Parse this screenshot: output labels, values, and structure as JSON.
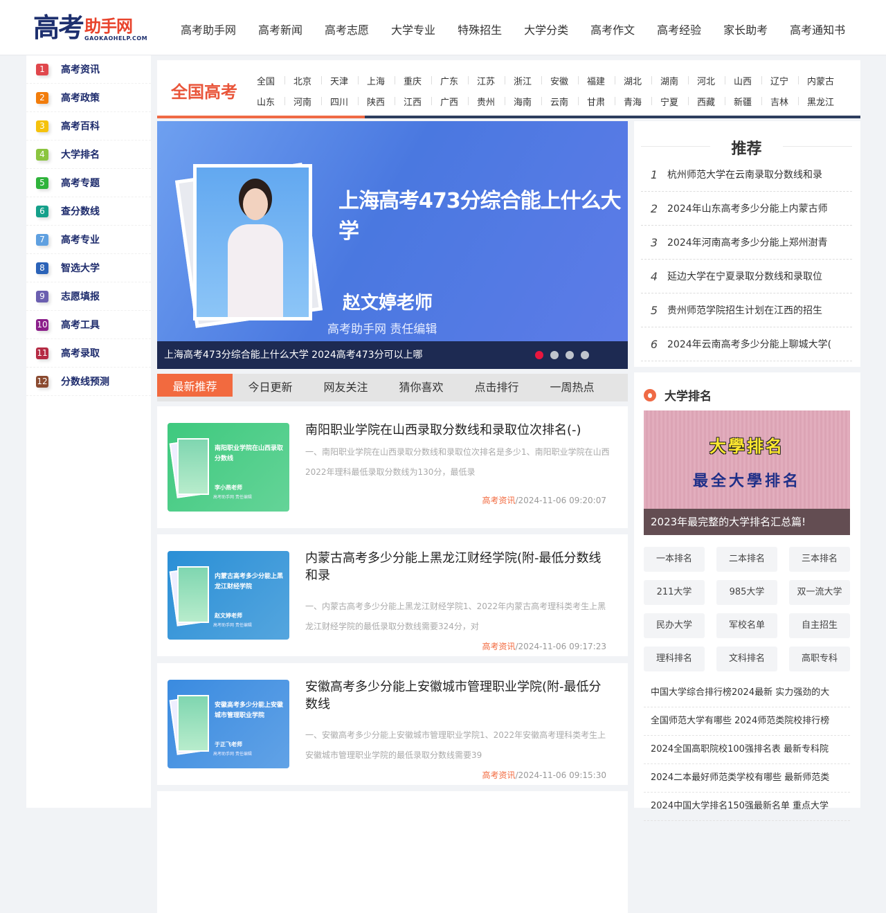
{
  "logo": {
    "cn_big": "高考",
    "cn_red": "助手网",
    "en": "GAOKAOHELP.COM"
  },
  "nav": [
    "高考助手网",
    "高考新闻",
    "高考志愿",
    "大学专业",
    "特殊招生",
    "大学分类",
    "高考作文",
    "高考经验",
    "家长助考",
    "高考通知书"
  ],
  "sidebar": [
    {
      "num": "1",
      "label": "高考资讯",
      "color": "#e0474c"
    },
    {
      "num": "2",
      "label": "高考政策",
      "color": "#f27d0c"
    },
    {
      "num": "3",
      "label": "高考百科",
      "color": "#f5c20d"
    },
    {
      "num": "4",
      "label": "大学排名",
      "color": "#8bc540"
    },
    {
      "num": "5",
      "label": "高考专题",
      "color": "#2fb33b"
    },
    {
      "num": "6",
      "label": "查分数线",
      "color": "#15a08a"
    },
    {
      "num": "7",
      "label": "高考专业",
      "color": "#5fa0e0"
    },
    {
      "num": "8",
      "label": "智选大学",
      "color": "#2b63b8"
    },
    {
      "num": "9",
      "label": "志愿填报",
      "color": "#6b5fb0"
    },
    {
      "num": "10",
      "label": "高考工具",
      "color": "#8b1e8a"
    },
    {
      "num": "11",
      "label": "高考录取",
      "color": "#b52b44"
    },
    {
      "num": "12",
      "label": "分数线预测",
      "color": "#8a4a30"
    }
  ],
  "category": {
    "title": "全国高考",
    "row1": [
      "全国",
      "北京",
      "天津",
      "上海",
      "重庆",
      "广东",
      "江苏",
      "浙江",
      "安徽",
      "福建",
      "湖北",
      "湖南",
      "河北",
      "山西",
      "辽宁",
      "内蒙古"
    ],
    "row2": [
      "山东",
      "河南",
      "四川",
      "陕西",
      "江西",
      "广西",
      "贵州",
      "海南",
      "云南",
      "甘肃",
      "青海",
      "宁夏",
      "西藏",
      "新疆",
      "吉林",
      "黑龙江"
    ]
  },
  "banner": {
    "title": "上海高考473分综合能上什么大学",
    "teacher": "赵文婷老师",
    "role": "高考助手网  责任编辑",
    "caption": "上海高考473分综合能上什么大学 2024高考473分可以上哪",
    "slides": 4,
    "active_slide": 1
  },
  "recommend": {
    "title": "推荐",
    "items": [
      {
        "n": "1",
        "t": "杭州师范大学在云南录取分数线和录"
      },
      {
        "n": "2",
        "t": "2024年山东高考多少分能上内蒙古师"
      },
      {
        "n": "3",
        "t": "2024年河南高考多少分能上郑州澍青"
      },
      {
        "n": "4",
        "t": "延边大学在宁夏录取分数线和录取位"
      },
      {
        "n": "5",
        "t": "贵州师范学院招生计划在江西的招生"
      },
      {
        "n": "6",
        "t": "2024年云南高考多少分能上聊城大学("
      }
    ]
  },
  "tabs": [
    "最新推荐",
    "今日更新",
    "网友关注",
    "猜你喜欢",
    "点击排行",
    "一周热点"
  ],
  "articles": [
    {
      "title": "南阳职业学院在山西录取分数线和录取位次排名(-)",
      "desc": "一、南阳职业学院在山西录取分数线和录取位次排名是多少1、南阳职业学院在山西2022年理科最低录取分数线为130分，最低录",
      "tag": "高考资讯",
      "time": "2024-11-06 09:20:07",
      "thumb_title": "南阳职业学院在山西录取分数线",
      "thumb_name": "李小燕老师",
      "thumb_role": "高考助手网 责任编辑",
      "thumb_color": "#3ec97e"
    },
    {
      "title": "内蒙古高考多少分能上黑龙江财经学院(附-最低分数线和录",
      "desc": "一、内蒙古高考多少分能上黑龙江财经学院1、2022年内蒙古高考理科类考生上黑龙江财经学院的最低录取分数线需要324分，对",
      "tag": "高考资讯",
      "time": "2024-11-06 09:17:23",
      "thumb_title": "内蒙古高考多少分能上黑龙江财经学院",
      "thumb_name": "赵文婷老师",
      "thumb_role": "高考助手网 责任编辑",
      "thumb_color": "#2a8fd6"
    },
    {
      "title": "安徽高考多少分能上安徽城市管理职业学院(附-最低分数线",
      "desc": "一、安徽高考多少分能上安徽城市管理职业学院1、2022年安徽高考理科类考生上安徽城市管理职业学院的最低录取分数线需要39",
      "tag": "高考资讯",
      "time": "2024-11-06 09:15:30",
      "thumb_title": "安徽高考多少分能上安徽城市管理职业学院",
      "thumb_name": "于正飞老师",
      "thumb_role": "高考助手网 责任编辑",
      "thumb_color": "#3a8be0"
    }
  ],
  "ranking": {
    "title": "大学排名",
    "img_line1": "大學排名",
    "img_line2": "最全大學排名",
    "img_caption": "2023年最完整的大学排名汇总篇!",
    "buttons": [
      "一本排名",
      "二本排名",
      "三本排名",
      "211大学",
      "985大学",
      "双一流大学",
      "民办大学",
      "军校名单",
      "自主招生",
      "理科排名",
      "文科排名",
      "高职专科"
    ],
    "links": [
      "中国大学综合排行榜2024最新 实力强劲的大",
      "全国师范大学有哪些 2024师范类院校排行榜",
      "2024全国高职院校100强排名表 最新专科院",
      "2024二本最好师范类学校有哪些 最新师范类",
      "2024中国大学排名150强最新名单 重点大学"
    ]
  },
  "colors": {
    "accent": "#f26a3f",
    "navy": "#1c2a6b"
  }
}
